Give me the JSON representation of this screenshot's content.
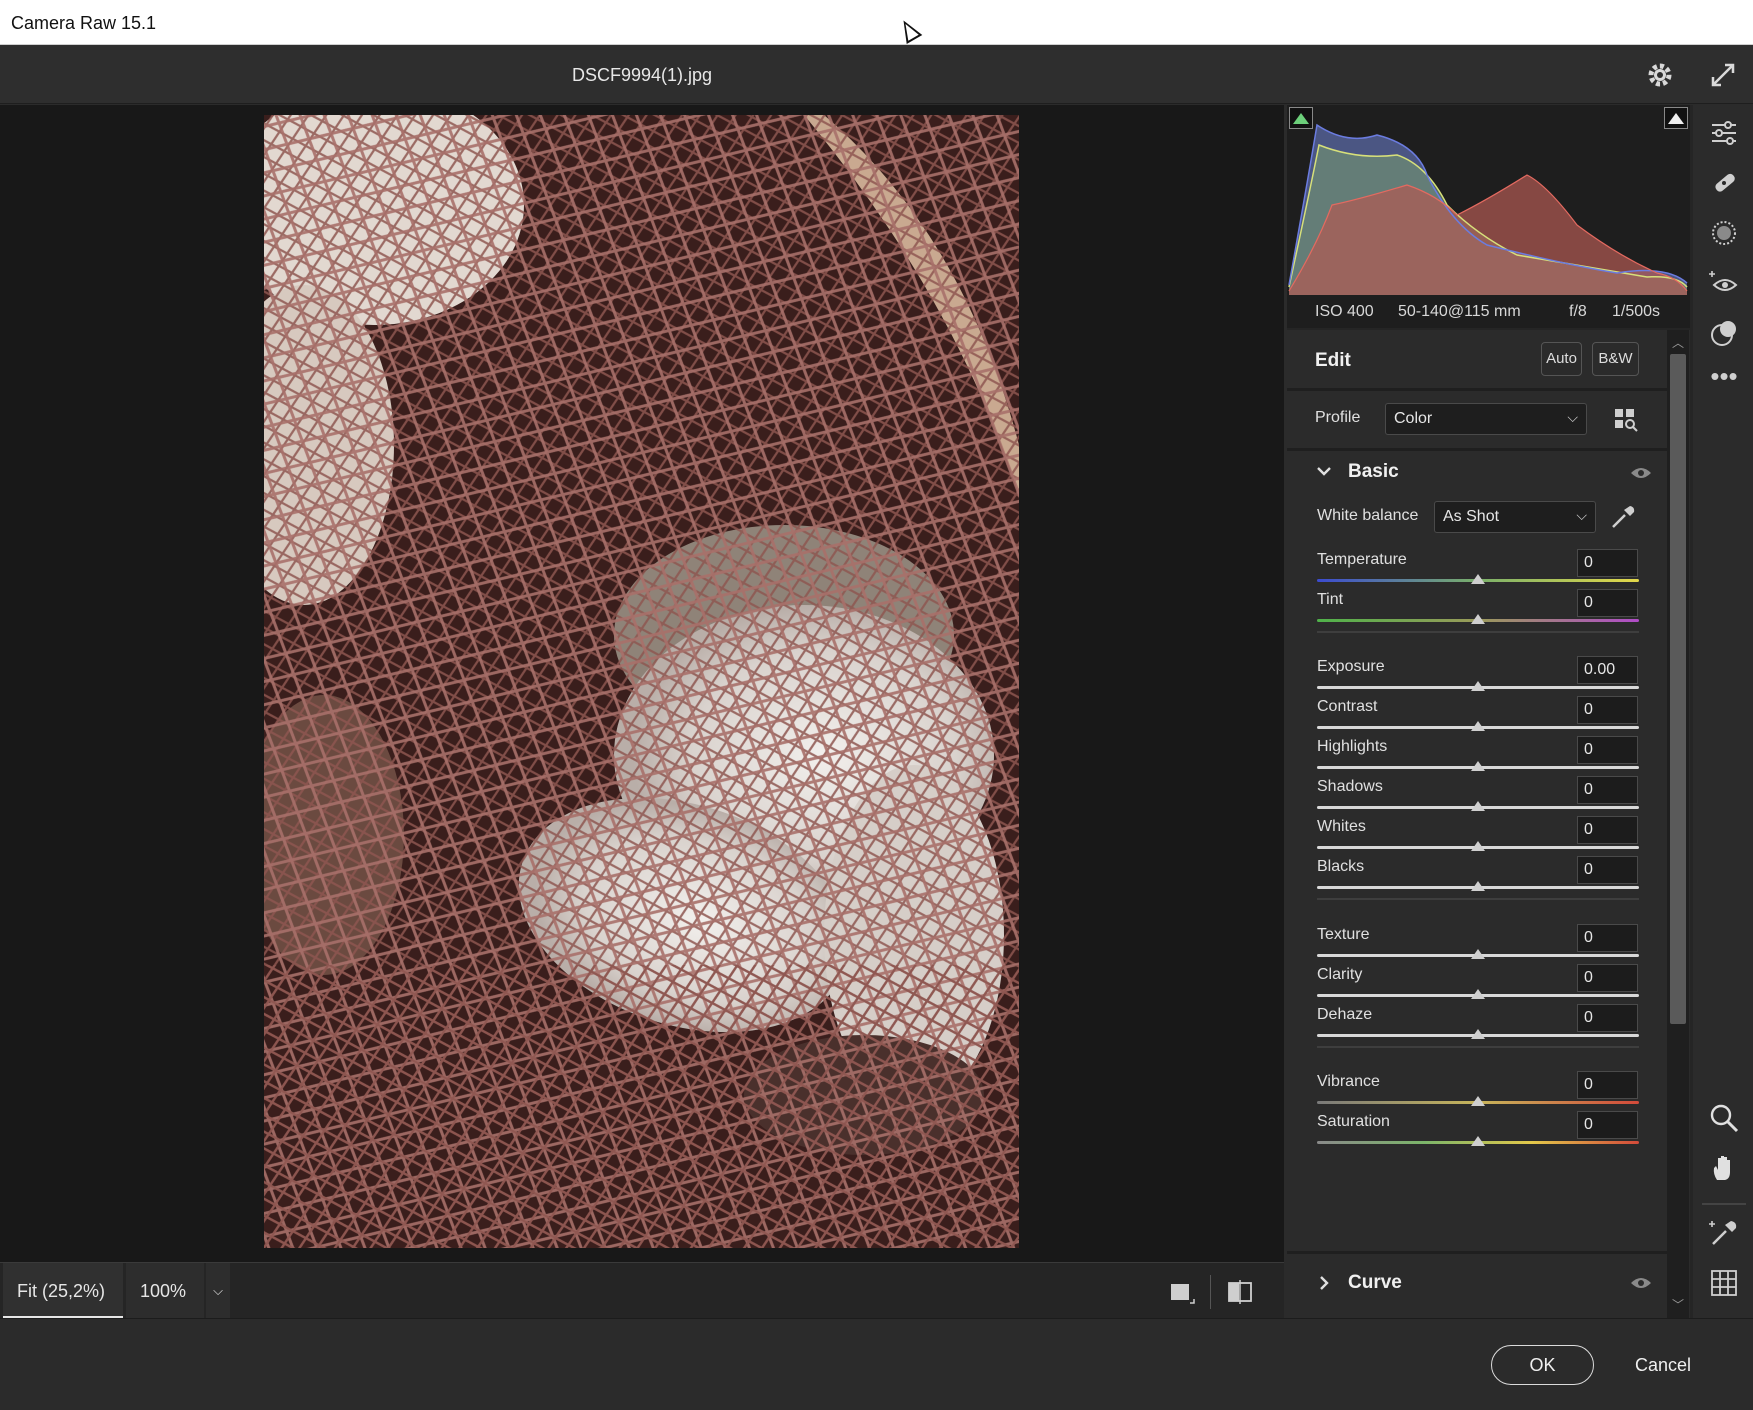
{
  "window": {
    "title": "Camera Raw 15.1"
  },
  "header": {
    "filename": "DSCF9994(1).jpg",
    "icons": [
      "gear-icon",
      "fullscreen-icon"
    ]
  },
  "histogram": {
    "exif": {
      "iso": "ISO 400",
      "lens": "50-140@115 mm",
      "aperture": "f/8",
      "shutter": "1/500s"
    }
  },
  "edit": {
    "title": "Edit",
    "auto_label": "Auto",
    "bw_label": "B&W",
    "profile_label": "Profile",
    "profile_value": "Color"
  },
  "basic": {
    "title": "Basic",
    "white_balance_label": "White balance",
    "white_balance_value": "As Shot",
    "sliders": [
      {
        "label": "Temperature",
        "value": "0"
      },
      {
        "label": "Tint",
        "value": "0"
      },
      {
        "label": "Exposure",
        "value": "0.00"
      },
      {
        "label": "Contrast",
        "value": "0"
      },
      {
        "label": "Highlights",
        "value": "0"
      },
      {
        "label": "Shadows",
        "value": "0"
      },
      {
        "label": "Whites",
        "value": "0"
      },
      {
        "label": "Blacks",
        "value": "0"
      },
      {
        "label": "Texture",
        "value": "0"
      },
      {
        "label": "Clarity",
        "value": "0"
      },
      {
        "label": "Dehaze",
        "value": "0"
      },
      {
        "label": "Vibrance",
        "value": "0"
      },
      {
        "label": "Saturation",
        "value": "0"
      }
    ],
    "slider_position": 0.5
  },
  "curve": {
    "title": "Curve"
  },
  "viewbar": {
    "fit_label": "Fit (25,2%)",
    "zoom_label": "100%"
  },
  "footer": {
    "ok_label": "OK",
    "cancel_label": "Cancel"
  },
  "colors": {
    "accent": "#e6e6e6",
    "panel": "#2b2b2b",
    "viewer": "#181818"
  }
}
